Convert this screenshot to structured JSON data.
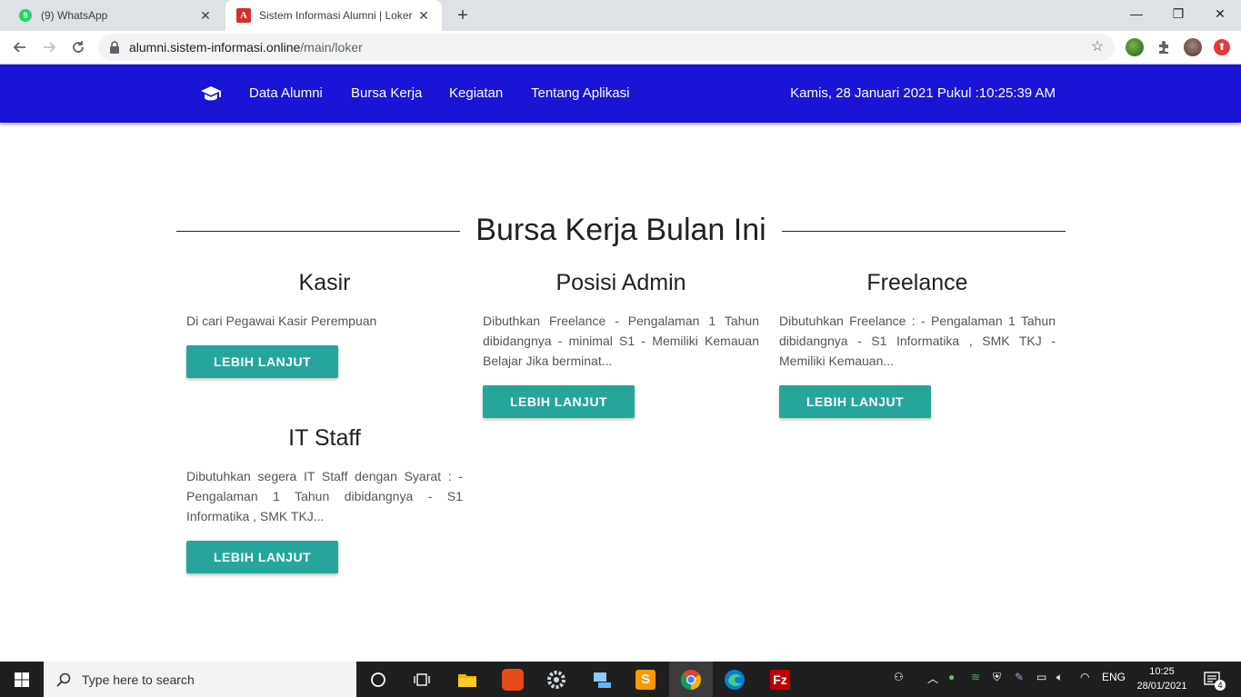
{
  "browser": {
    "tabs": [
      {
        "title": "(9) WhatsApp",
        "badge": "9"
      },
      {
        "title": "Sistem Informasi Alumni | Loker",
        "favicon_letter": "A"
      }
    ],
    "new_tab_symbol": "+",
    "url_host": "alumni.sistem-informasi.online",
    "url_path": "/main/loker"
  },
  "navbar": {
    "links": [
      "Data Alumni",
      "Bursa Kerja",
      "Kegiatan",
      "Tentang Aplikasi"
    ],
    "clock": "Kamis, 28 Januari 2021 Pukul :10:25:39 AM",
    "color": "#1a14d6"
  },
  "main": {
    "section_title": "Bursa Kerja Bulan Ini",
    "button_color": "#26a69a",
    "jobs": [
      {
        "title": "Kasir",
        "description": "Di cari Pegawai Kasir Perempuan",
        "button": "LEBIH LANJUT"
      },
      {
        "title": "Posisi Admin",
        "description": "Dibuthkan Freelance - Pengalaman 1 Tahun dibidangnya - minimal S1 - Memiliki Kemauan Belajar Jika berminat...",
        "button": "LEBIH LANJUT"
      },
      {
        "title": "Freelance",
        "description": "Dibutuhkan Freelance : - Pengalaman 1 Tahun dibidangnya - S1 Informatika , SMK TKJ - Memiliki Kemauan...",
        "button": "LEBIH LANJUT"
      },
      {
        "title": "IT Staff",
        "description": "Dibutuhkan segera IT Staff dengan Syarat : - Pengalaman 1 Tahun dibidangnya - S1 Informatika , SMK TKJ...",
        "button": "LEBIH LANJUT"
      }
    ]
  },
  "taskbar": {
    "search_placeholder": "Type here to search",
    "language": "ENG",
    "time": "10:25",
    "date": "28/01/2021",
    "notification_count": "4"
  }
}
